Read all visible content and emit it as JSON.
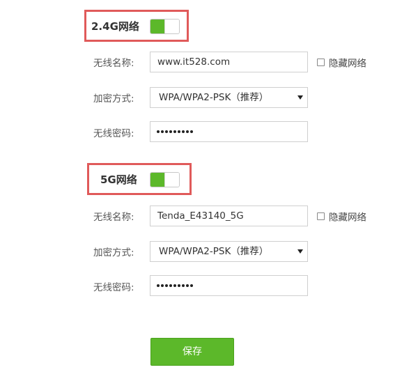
{
  "bands": [
    {
      "title": "2.4G网络",
      "enabled": true,
      "ssid_label": "无线名称:",
      "ssid_value": "www.it528.com",
      "hide_label": "隐藏网络",
      "hide_checked": false,
      "encryption_label": "加密方式:",
      "encryption_value": "WPA/WPA2-PSK（推荐）",
      "password_label": "无线密码:",
      "password_mask": "•••••••••"
    },
    {
      "title": "5G网络",
      "enabled": true,
      "ssid_label": "无线名称:",
      "ssid_value": "Tenda_E43140_5G",
      "hide_label": "隐藏网络",
      "hide_checked": false,
      "encryption_label": "加密方式:",
      "encryption_value": "WPA/WPA2-PSK（推荐）",
      "password_label": "无线密码:",
      "password_mask": "•••••••••"
    }
  ],
  "save_label": "保存",
  "colors": {
    "accent_green": "#5cb82a",
    "highlight_red": "#e05a5a"
  },
  "icons": {
    "select_arrow": "chevron-down-icon",
    "toggle": "toggle-switch-icon"
  }
}
